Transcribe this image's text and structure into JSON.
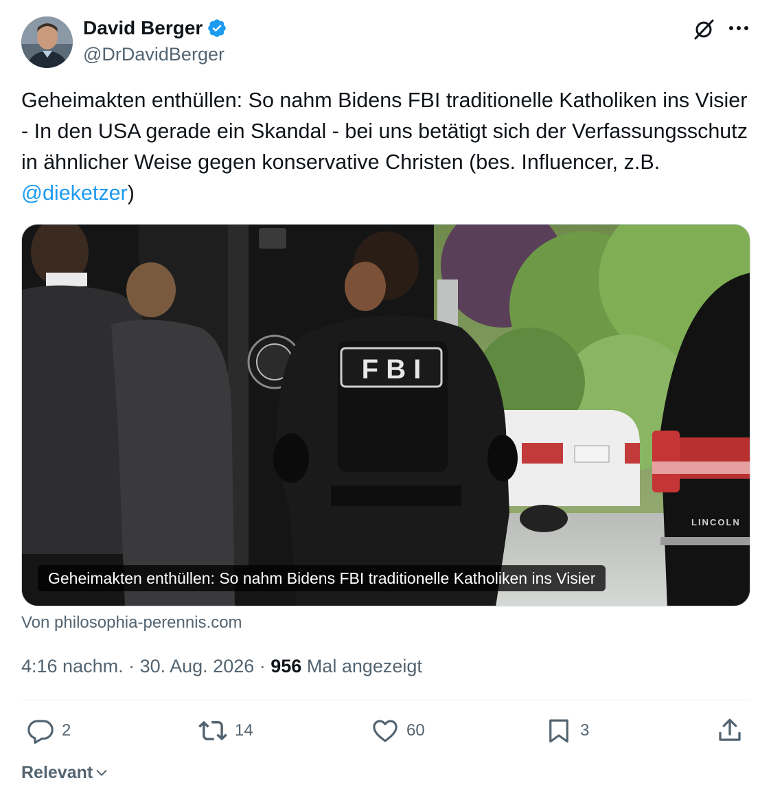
{
  "author": {
    "display_name": "David Berger",
    "handle": "@DrDavidBerger",
    "verified": true
  },
  "icons": {
    "avatar": "avatar",
    "verified": "verified-badge-icon",
    "grok": "grok-icon",
    "more": "more-horizontal-icon",
    "reply": "reply-icon",
    "repost": "repost-icon",
    "like": "like-heart-icon",
    "bookmark": "bookmark-icon",
    "share": "share-icon",
    "chevron": "chevron-down-icon"
  },
  "tweet": {
    "text_part1": "Geheimakten enthüllen: So nahm Bidens FBI traditionelle Katholiken ins Visier - In den USA gerade ein Skandal - bei uns betätigt sich der Verfassungsschutz in ähnlicher Weise gegen konservative Christen (bes. Influencer, z.B. ",
    "mention": "@dieketzer",
    "text_part2": ")"
  },
  "card": {
    "caption": "Geheimakten enthüllen: So nahm Bidens FBI traditionelle Katholiken ins Visier",
    "source": "Von philosophia-perennis.com",
    "vest_label": "F B I",
    "car_badge": "LINCOLN"
  },
  "meta": {
    "time": "4:16 nachm.",
    "separator": " · ",
    "date": "30. Aug. 2026",
    "views_count": "956",
    "views_label": " Mal angezeigt"
  },
  "actions": {
    "replies": "2",
    "reposts": "14",
    "likes": "60",
    "bookmarks": "3"
  },
  "sort": {
    "label": "Relevant"
  },
  "colors": {
    "text": "#0f1419",
    "secondary": "#536471",
    "link": "#1d9bf0",
    "border": "#cfd9de",
    "divider": "#eff3f4"
  }
}
